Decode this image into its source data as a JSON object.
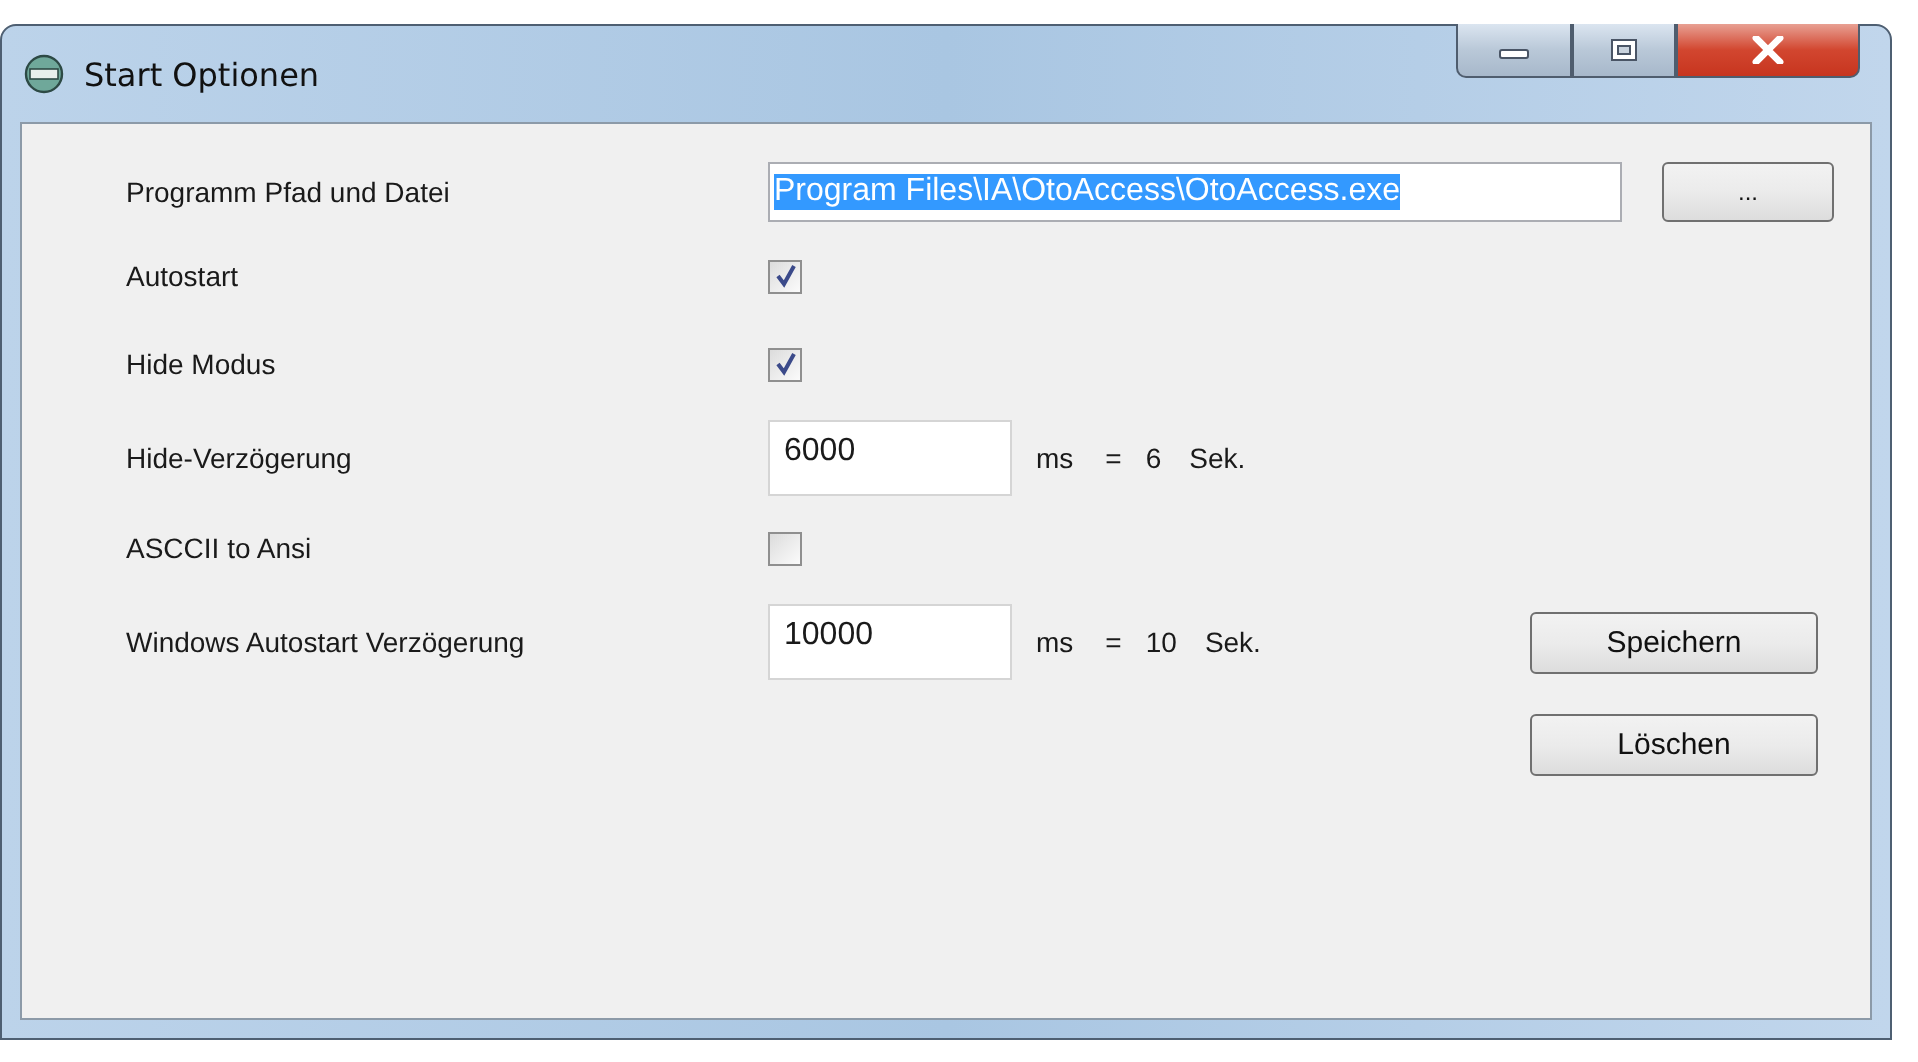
{
  "window": {
    "title": "Start Optionen"
  },
  "rows": [
    {
      "kind": "path",
      "label": "Programm Pfad und Datei",
      "value": "Program Files\\IA\\OtoAccess\\OtoAccess.exe",
      "selected": true,
      "button": "..."
    },
    {
      "kind": "checkbox",
      "label": "Autostart",
      "checked": true
    },
    {
      "kind": "checkbox",
      "label": "Hide Modus",
      "checked": true
    },
    {
      "kind": "delay",
      "label": "Hide-Verzögerung",
      "value": "6000",
      "unit": "ms",
      "equals": "=",
      "seconds": "6",
      "seconds_unit": "Sek."
    },
    {
      "kind": "checkbox",
      "label": "ASCCII to Ansi",
      "checked": false
    },
    {
      "kind": "delay",
      "label": "Windows Autostart Verzögerung",
      "value": "10000",
      "unit": "ms",
      "equals": "=",
      "seconds": "10",
      "seconds_unit": "Sek."
    }
  ],
  "buttons": [
    "Speichern",
    "Löschen"
  ]
}
